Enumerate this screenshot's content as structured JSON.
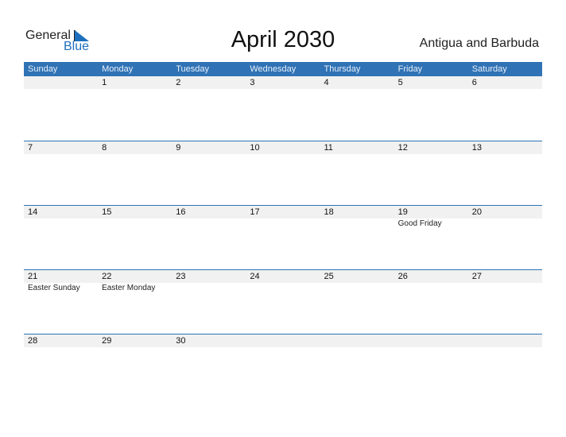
{
  "logo": {
    "word1": "General",
    "word2": "Blue"
  },
  "title": "April 2030",
  "country": "Antigua and Barbuda",
  "colors": {
    "accent": "#2f72b5",
    "datebar": "#f1f1f1"
  },
  "weekdays": [
    "Sunday",
    "Monday",
    "Tuesday",
    "Wednesday",
    "Thursday",
    "Friday",
    "Saturday"
  ],
  "weeks": [
    {
      "days": [
        "",
        "1",
        "2",
        "3",
        "4",
        "5",
        "6"
      ],
      "events": [
        "",
        "",
        "",
        "",
        "",
        "",
        ""
      ]
    },
    {
      "days": [
        "7",
        "8",
        "9",
        "10",
        "11",
        "12",
        "13"
      ],
      "events": [
        "",
        "",
        "",
        "",
        "",
        "",
        ""
      ]
    },
    {
      "days": [
        "14",
        "15",
        "16",
        "17",
        "18",
        "19",
        "20"
      ],
      "events": [
        "",
        "",
        "",
        "",
        "",
        "Good Friday",
        ""
      ]
    },
    {
      "days": [
        "21",
        "22",
        "23",
        "24",
        "25",
        "26",
        "27"
      ],
      "events": [
        "Easter Sunday",
        "Easter Monday",
        "",
        "",
        "",
        "",
        ""
      ]
    },
    {
      "days": [
        "28",
        "29",
        "30",
        "",
        "",
        "",
        ""
      ],
      "events": [
        "",
        "",
        "",
        "",
        "",
        "",
        ""
      ]
    }
  ]
}
